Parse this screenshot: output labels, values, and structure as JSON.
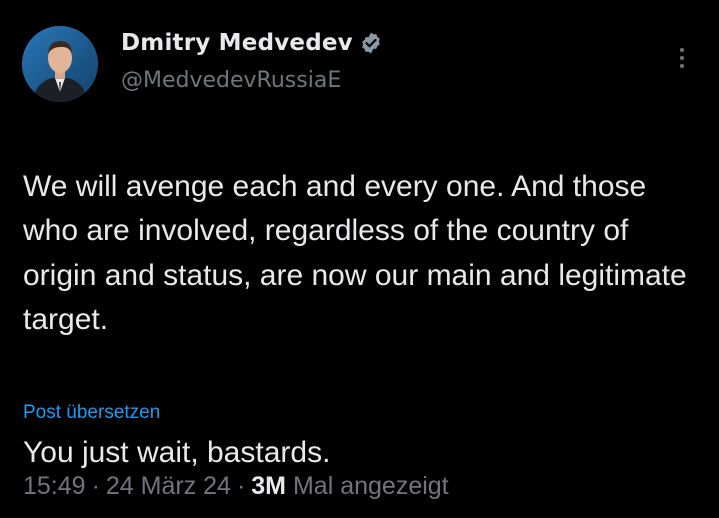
{
  "author": {
    "display_name": "Dmitry Medvedev",
    "handle": "@MedvedevRussiaE",
    "verified_icon": "verified-badge-icon",
    "verified_color": "#8b98a5"
  },
  "tweet": {
    "paragraph_1": "We will avenge each and every one. And those who are involved, regardless of the country of origin and status, are now our main and legitimate target.",
    "paragraph_2": "You just wait, bastards."
  },
  "translate_label": "Post übersetzen",
  "meta": {
    "time": "15:49",
    "separator_1": "·",
    "date": "24 März 24",
    "separator_2": "·",
    "views_count": "3M",
    "views_label": "Mal angezeigt"
  },
  "colors": {
    "background": "#000000",
    "primary_text": "#e7e9ea",
    "secondary_text": "#71767b",
    "link": "#1d9bf0"
  }
}
